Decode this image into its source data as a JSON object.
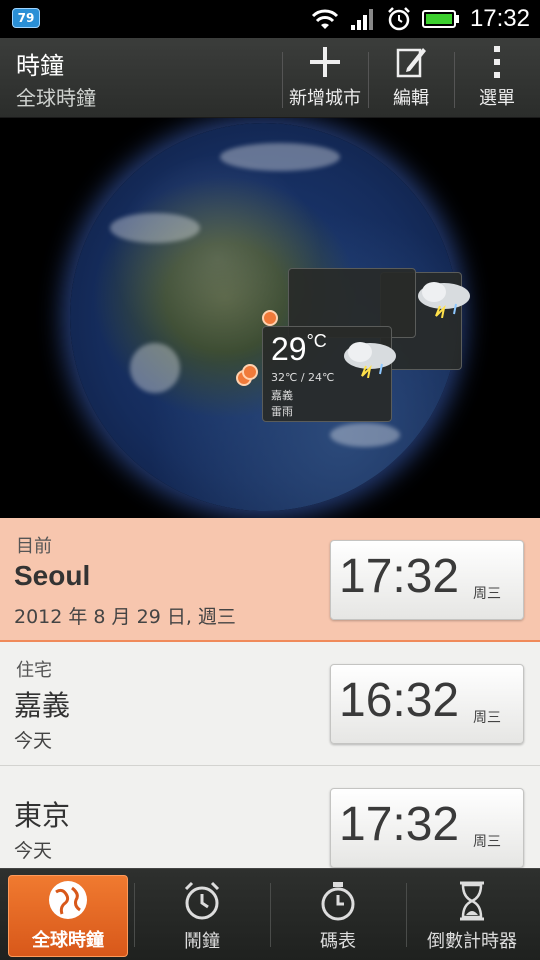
{
  "status_bar": {
    "badge": "79",
    "time": "17:32",
    "icons": [
      "wifi-icon",
      "signal-icon",
      "alarm-icon",
      "battery-icon"
    ]
  },
  "action_bar": {
    "title": "時鐘",
    "subtitle": "全球時鐘",
    "add_city_label": "新增城市",
    "edit_label": "編輯",
    "menu_label": "選單"
  },
  "globe": {
    "weather_card": {
      "temp": "29",
      "unit": "°C",
      "range": "32℃ / 24℃",
      "city": "嘉義",
      "condition": "雷雨"
    }
  },
  "cities": [
    {
      "label": "目前",
      "city": "Seoul",
      "date": "2012 年 8 月 29 日, 週三",
      "time": "17:32",
      "day": "周三",
      "current": true
    },
    {
      "label": "住宅",
      "city": "嘉義",
      "date": "今天",
      "time": "16:32",
      "day": "周三",
      "current": false
    },
    {
      "label": "",
      "city": "東京",
      "date": "今天",
      "time": "17:32",
      "day": "周三",
      "current": false
    }
  ],
  "tabs": [
    {
      "label": "全球時鐘",
      "icon": "globe-icon",
      "active": true
    },
    {
      "label": "鬧鐘",
      "icon": "alarm-clock-icon",
      "active": false
    },
    {
      "label": "碼表",
      "icon": "stopwatch-icon",
      "active": false
    },
    {
      "label": "倒數計時器",
      "icon": "hourglass-icon",
      "active": false
    }
  ],
  "colors": {
    "accent": "#f07a30",
    "current_row": "#f7c6ae",
    "row_bg": "#f1f1ef"
  }
}
